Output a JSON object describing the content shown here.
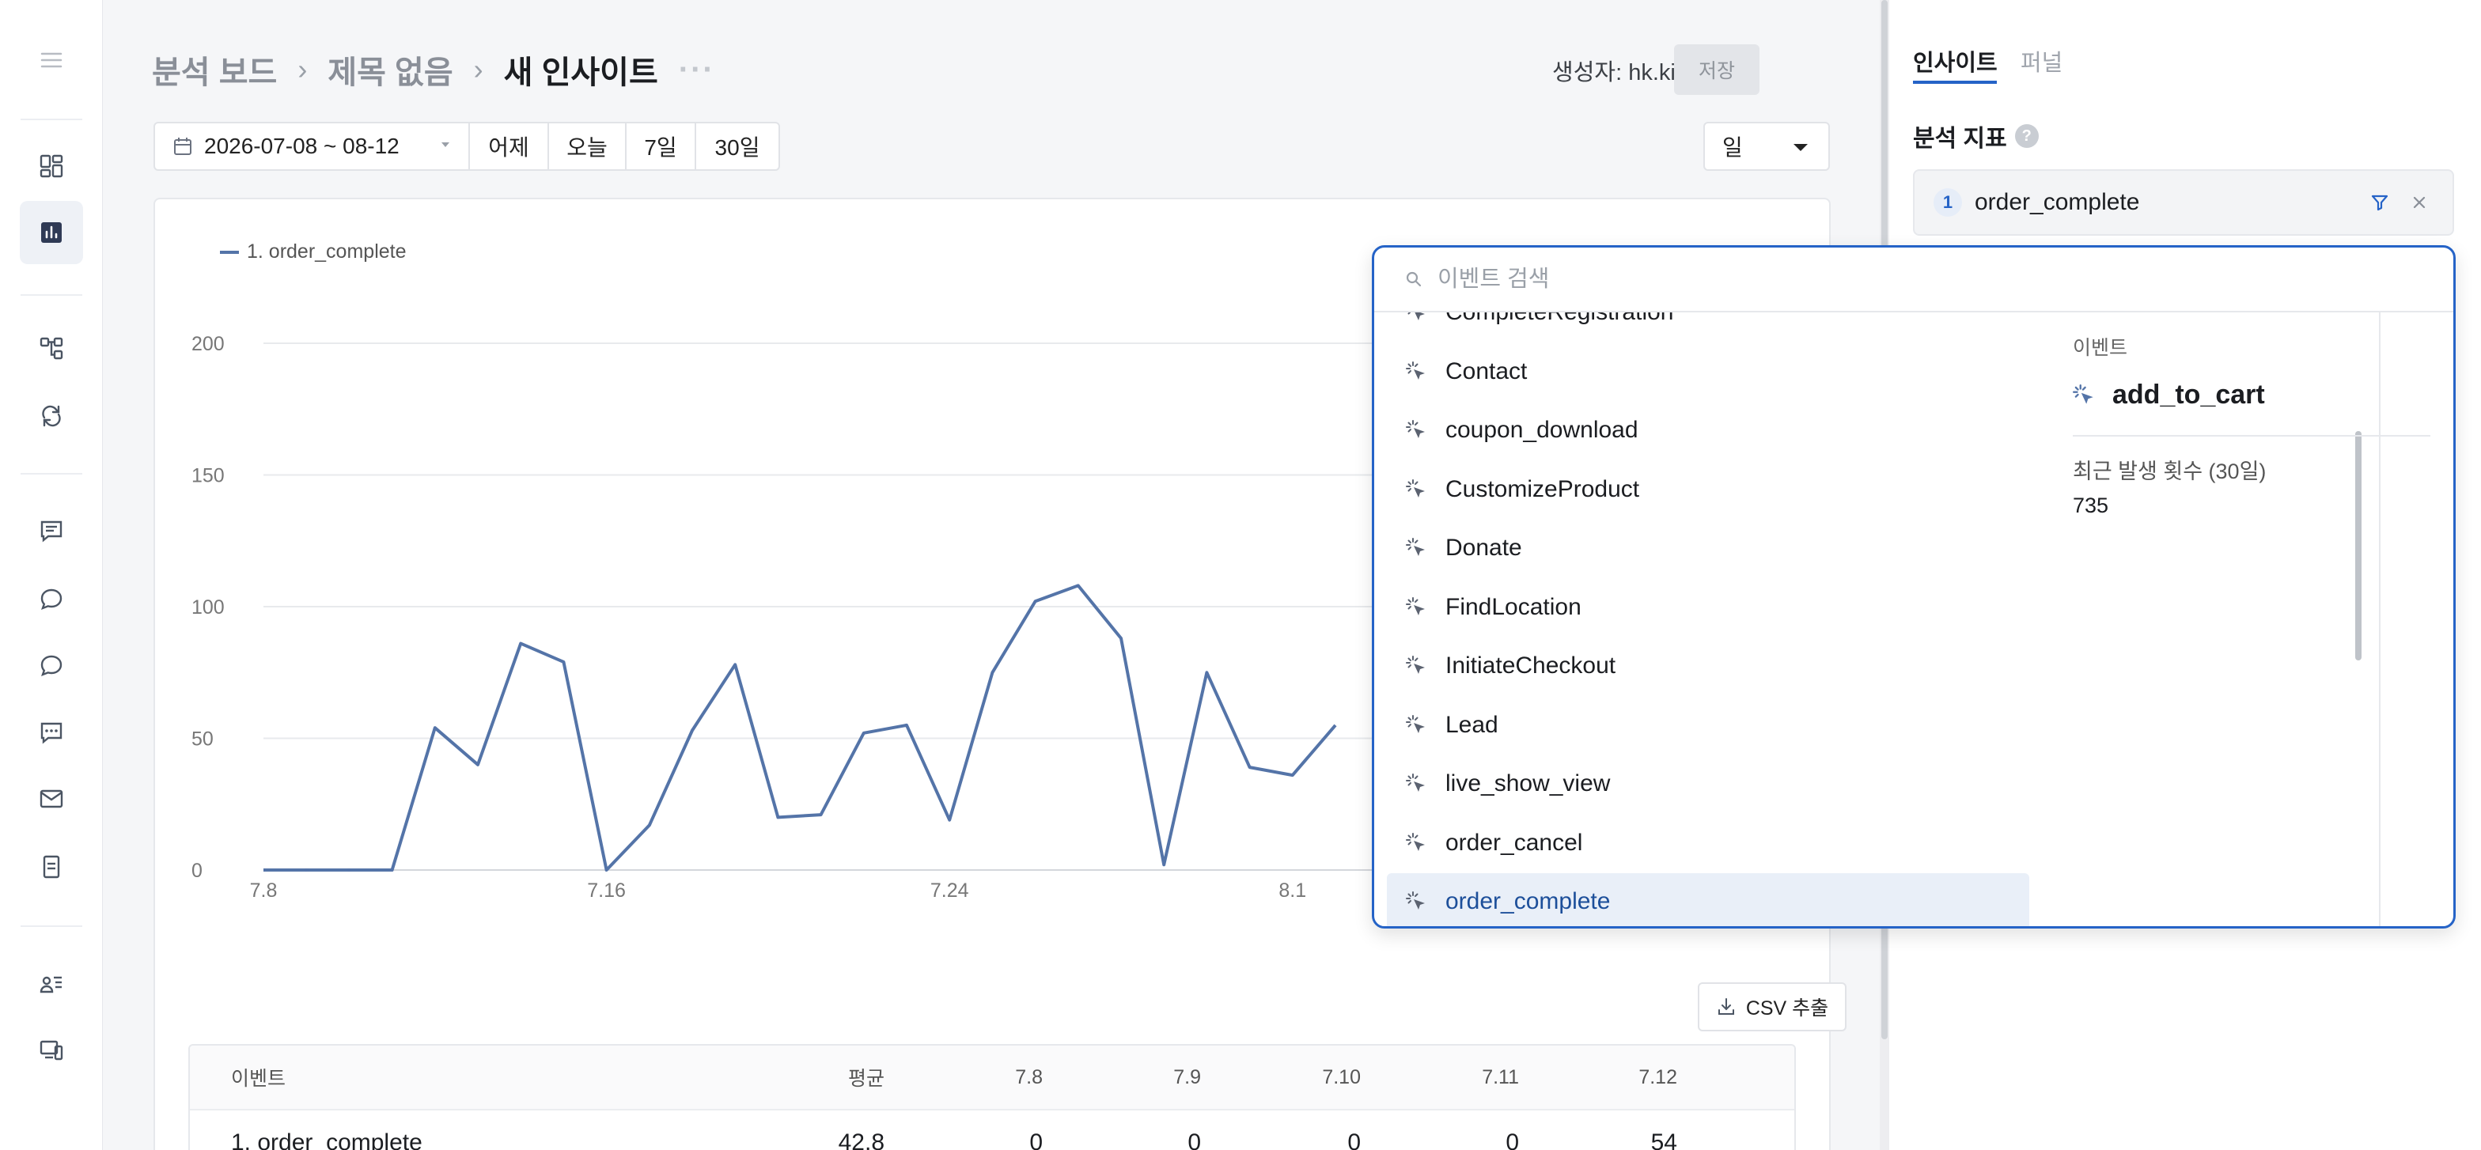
{
  "breadcrumb": {
    "root": "분석 보드",
    "board": "제목 없음",
    "current": "새 인사이트",
    "more": "···"
  },
  "header": {
    "creator_label": "생성자:",
    "creator_name": "hk.kim",
    "save_label": "저장"
  },
  "date_range": {
    "value": "2026-07-08 ~ 08-12",
    "quick_buttons": [
      "어제",
      "오늘",
      "7일",
      "30일"
    ]
  },
  "interval": {
    "selected": "일"
  },
  "chart": {
    "legend": "1. order_complete",
    "csv_label": "CSV 추출"
  },
  "chart_data": {
    "type": "line",
    "title": "",
    "xlabel": "",
    "ylabel": "",
    "ylim": [
      0,
      200
    ],
    "yticks": [
      0,
      50,
      100,
      150,
      200
    ],
    "xtick_labels": [
      "7.8",
      "7.16",
      "7.24",
      "8.1"
    ],
    "x": [
      "7.8",
      "7.9",
      "7.10",
      "7.11",
      "7.12",
      "7.13",
      "7.14",
      "7.15",
      "7.16",
      "7.17",
      "7.18",
      "7.19",
      "7.20",
      "7.21",
      "7.22",
      "7.23",
      "7.24",
      "7.25",
      "7.26",
      "7.27",
      "7.28",
      "7.29",
      "7.30",
      "7.31",
      "8.1",
      "8.2"
    ],
    "series": [
      {
        "name": "1. order_complete",
        "color": "#5474a8",
        "values": [
          0,
          0,
          0,
          0,
          54,
          40,
          86,
          79,
          0,
          17,
          53,
          78,
          20,
          21,
          52,
          55,
          19,
          75,
          102,
          108,
          88,
          2,
          75,
          39,
          36,
          55
        ]
      }
    ]
  },
  "table": {
    "headers": [
      "이벤트",
      "평균",
      "7.8",
      "7.9",
      "7.10",
      "7.11",
      "7.12"
    ],
    "rows": [
      {
        "event": "1. order_complete",
        "avg": "42.8",
        "cells": [
          "0",
          "0",
          "0",
          "0",
          "54"
        ]
      }
    ]
  },
  "right_panel": {
    "tabs": [
      "인사이트",
      "퍼널"
    ],
    "metric_title": "분석 지표",
    "help": "?",
    "metric": {
      "index": "1",
      "name": "order_complete"
    }
  },
  "event_picker": {
    "search_placeholder": "이벤트 검색",
    "items": [
      "CompleteRegistration",
      "Contact",
      "coupon_download",
      "CustomizeProduct",
      "Donate",
      "FindLocation",
      "InitiateCheckout",
      "Lead",
      "live_show_view",
      "order_cancel",
      "order_complete"
    ],
    "selected": "order_complete",
    "detail": {
      "label": "이벤트",
      "name": "add_to_cart",
      "count_label": "최근 발생 횟수 (30일)",
      "count": "735"
    }
  },
  "icons": {
    "accent": "#2563c7",
    "rail": [
      "menu-icon",
      "dashboard-icon",
      "chart-icon",
      "flow-icon",
      "refresh-icon",
      "message-icon",
      "chat-icon",
      "chat-icon",
      "sms-icon",
      "mail-icon",
      "document-icon",
      "user-list-icon",
      "devices-icon"
    ]
  }
}
